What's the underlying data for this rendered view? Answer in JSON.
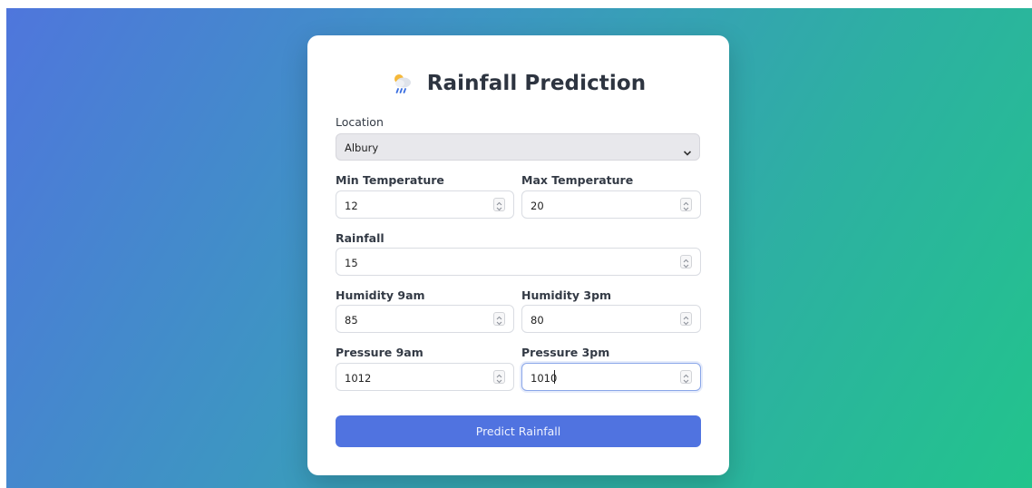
{
  "header": {
    "title": "Rainfall Prediction",
    "icon": "cloud-rain-sun-icon"
  },
  "form": {
    "location": {
      "label": "Location",
      "value": "Albury"
    },
    "min_temp": {
      "label": "Min Temperature",
      "value": "12"
    },
    "max_temp": {
      "label": "Max Temperature",
      "value": "20"
    },
    "rainfall": {
      "label": "Rainfall",
      "value": "15"
    },
    "humidity_9am": {
      "label": "Humidity 9am",
      "value": "85"
    },
    "humidity_3pm": {
      "label": "Humidity 3pm",
      "value": "80"
    },
    "pressure_9am": {
      "label": "Pressure 9am",
      "value": "1012"
    },
    "pressure_3pm": {
      "label": "Pressure 3pm",
      "value": "1010"
    },
    "submit_label": "Predict Rainfall"
  },
  "colors": {
    "button": "#5073e0",
    "gradient_start": "#4f76dc",
    "gradient_end": "#22c48c"
  }
}
